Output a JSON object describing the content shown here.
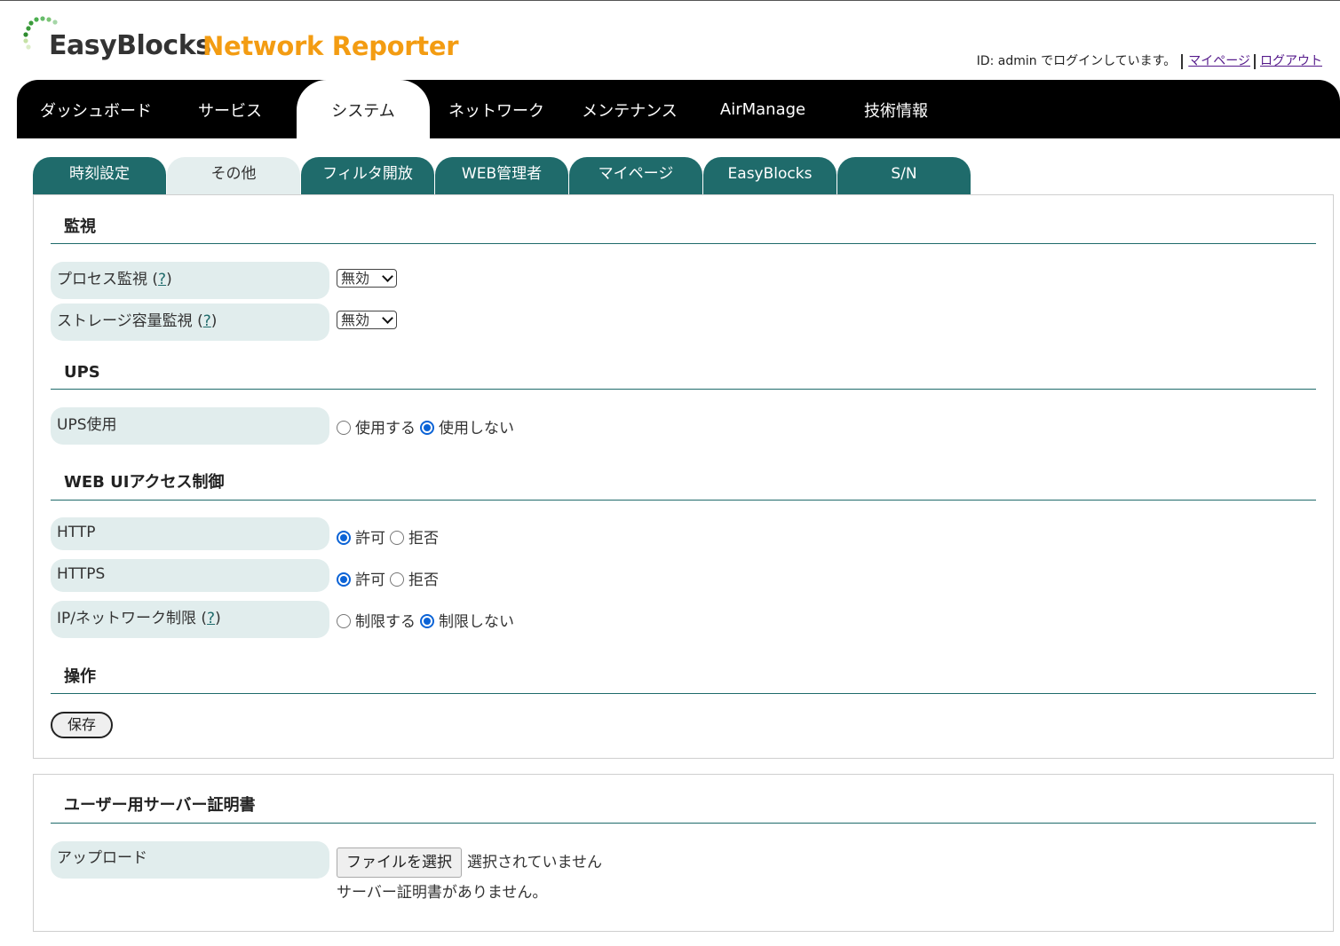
{
  "header": {
    "brand_name": "EasyBlocks",
    "product_name": "Network Reporter",
    "login_text": "ID: admin でログインしています。",
    "mypage_link": "マイページ",
    "logout_link": "ログアウト"
  },
  "mainnav": {
    "items": [
      "ダッシュボード",
      "サービス",
      "システム",
      "ネットワーク",
      "メンテナンス",
      "AirManage",
      "技術情報"
    ],
    "active": "システム"
  },
  "subtabs": {
    "items": [
      "時刻設定",
      "その他",
      "フィルタ開放",
      "WEB管理者",
      "マイページ",
      "EasyBlocks",
      "S/N"
    ],
    "active": "その他"
  },
  "monitoring": {
    "title": "監視",
    "process": {
      "label": "プロセス監視 ",
      "help": "?",
      "value": "無効"
    },
    "storage": {
      "label": "ストレージ容量監視 ",
      "help": "?",
      "value": "無効"
    }
  },
  "ups": {
    "title": "UPS",
    "label": "UPS使用",
    "options": [
      "使用する",
      "使用しない"
    ],
    "selected": "使用しない"
  },
  "webui": {
    "title": "WEB UIアクセス制御",
    "http": {
      "label": "HTTP",
      "options": [
        "許可",
        "拒否"
      ],
      "selected": "許可"
    },
    "https": {
      "label": "HTTPS",
      "options": [
        "許可",
        "拒否"
      ],
      "selected": "許可"
    },
    "ipnet": {
      "label": "IP/ネットワーク制限 ",
      "help": "?",
      "options": [
        "制限する",
        "制限しない"
      ],
      "selected": "制限しない"
    }
  },
  "operation": {
    "title": "操作",
    "save_label": "保存"
  },
  "cert": {
    "title": "ユーザー用サーバー証明書",
    "upload_label": "アップロード",
    "file_button": "ファイルを選択",
    "file_status": "選択されていません",
    "cert_status": "サーバー証明書がありません。"
  },
  "colors": {
    "nav_bg": "#000000",
    "tab_teal": "#1f6b6b",
    "tab_active": "#e4eeee",
    "label_bg": "#e1eded",
    "brand_orange": "#f39c12",
    "radio_blue": "#0b63d6"
  }
}
